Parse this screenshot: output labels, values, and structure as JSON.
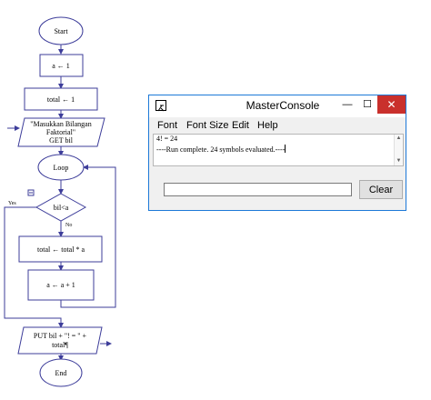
{
  "flowchart": {
    "start": "Start",
    "assign_a": "a ← 1",
    "assign_total": "total ← 1",
    "input_line1": "\"Masukkan Bilangan",
    "input_line2": "Faktorial\"",
    "input_line3": "GET bil",
    "loop": "Loop",
    "condition": "bil<a",
    "yes_label": "Yes",
    "no_label": "No",
    "multiply": "total ← total * a",
    "increment": "a ← a + 1",
    "output_line1": "PUT bil + \"! = \" +",
    "output_line2": "total¶",
    "end": "End"
  },
  "console": {
    "title": "MasterConsole",
    "minimize_glyph": "—",
    "maximize_glyph": "☐",
    "close_glyph": "✕",
    "menu": [
      "Font",
      "Font Size",
      "Edit",
      "Help"
    ],
    "output_lines": [
      "4! = 24",
      "----Run complete.  24 symbols evaluated.----"
    ],
    "input_value": "",
    "clear_label": "Clear",
    "scroll_up_glyph": "▲",
    "scroll_down_glyph": "▼"
  }
}
